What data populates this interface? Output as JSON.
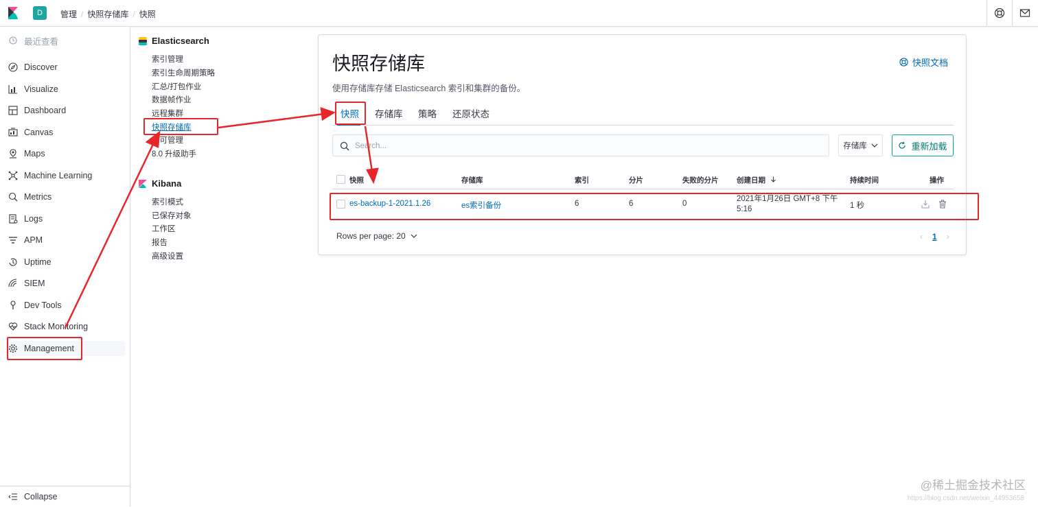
{
  "header": {
    "space_initial": "D",
    "breadcrumbs": [
      "管理",
      "快照存储库",
      "快照"
    ],
    "icons": [
      "kibana-logo-icon",
      "help-icon",
      "mail-icon"
    ]
  },
  "nav": {
    "recent": "最近查看",
    "items": [
      {
        "label": "Discover",
        "icon": "compass-icon"
      },
      {
        "label": "Visualize",
        "icon": "visualize-icon"
      },
      {
        "label": "Dashboard",
        "icon": "dashboard-icon"
      },
      {
        "label": "Canvas",
        "icon": "canvas-icon"
      },
      {
        "label": "Maps",
        "icon": "maps-icon"
      },
      {
        "label": "Machine Learning",
        "icon": "ml-icon"
      },
      {
        "label": "Metrics",
        "icon": "metrics-icon"
      },
      {
        "label": "Logs",
        "icon": "logs-icon"
      },
      {
        "label": "APM",
        "icon": "apm-icon"
      },
      {
        "label": "Uptime",
        "icon": "uptime-icon"
      },
      {
        "label": "SIEM",
        "icon": "siem-icon"
      },
      {
        "label": "Dev Tools",
        "icon": "devtools-icon"
      },
      {
        "label": "Stack Monitoring",
        "icon": "monitoring-icon"
      },
      {
        "label": "Management",
        "icon": "gear-icon"
      }
    ],
    "collapse": "Collapse"
  },
  "mgmt": {
    "es_title": "Elasticsearch",
    "es_links": [
      "索引管理",
      "索引生命周期策略",
      "汇总/打包作业",
      "数据帧作业",
      "远程集群",
      "快照存储库",
      "许可管理",
      "8.0 升级助手"
    ],
    "kibana_title": "Kibana",
    "kibana_links": [
      "索引模式",
      "已保存对象",
      "工作区",
      "报告",
      "高级设置"
    ]
  },
  "panel": {
    "title": "快照存储库",
    "docs_link": "快照文档",
    "description": "使用存储库存储 Elasticsearch 索引和集群的备份。",
    "tabs": [
      "快照",
      "存储库",
      "策略",
      "还原状态"
    ],
    "search_placeholder": "Search...",
    "filter_label": "存储库",
    "reload_label": "重新加载",
    "columns": {
      "snapshot": "快照",
      "repository": "存储库",
      "indices": "索引",
      "shards": "分片",
      "failed_shards": "失败的分片",
      "created": "创建日期",
      "duration": "持续时间",
      "actions": "操作"
    },
    "rows": [
      {
        "snapshot": "es-backup-1-2021.1.26",
        "repository": "es索引备份",
        "indices": "6",
        "shards": "6",
        "failed_shards": "0",
        "created_line1": "2021年1月26日 GMT+8 下午",
        "created_line2": "5:16",
        "duration": "1 秒"
      }
    ],
    "rows_per_page": "Rows per page: 20",
    "current_page": "1"
  },
  "watermark": {
    "main": "@稀土掘金技术社区",
    "sub": "https://blog.csdn.net/weixin_44953658"
  },
  "colors": {
    "accent": "#006bb8",
    "reload": "#017d73",
    "annotation": "#e8262a"
  }
}
